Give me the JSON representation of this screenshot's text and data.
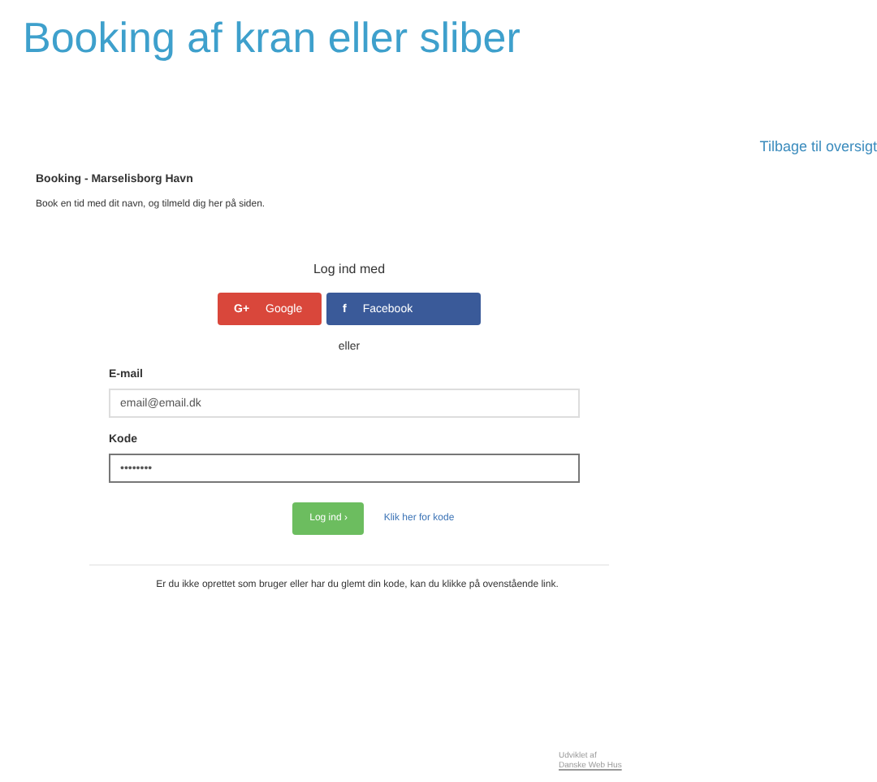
{
  "title": "Booking af kran eller sliber",
  "back_link": "Tilbage til oversigt",
  "heading": "Booking - Marselisborg Havn",
  "intro": "Book en tid med dit navn, og tilmeld dig her på siden.",
  "login": {
    "heading": "Log ind med",
    "social": [
      {
        "kind": "google",
        "icon": "G+",
        "label": "Google"
      },
      {
        "kind": "facebook",
        "icon": "f",
        "label": "Facebook"
      }
    ],
    "separator": "eller",
    "fields": [
      {
        "label": "E-mail",
        "value": "email@email.dk",
        "focused": false
      },
      {
        "label": "Kode",
        "value": "••••••••",
        "focused": true
      }
    ],
    "submit": "Log ind ›",
    "forgot_link": "Klik her for kode"
  },
  "note": "Er du ikke oprettet som bruger eller har du glemt din kode, kan du klikke på ovenstående link.",
  "credit": [
    "Udviklet af",
    "Danske Web Hus"
  ]
}
